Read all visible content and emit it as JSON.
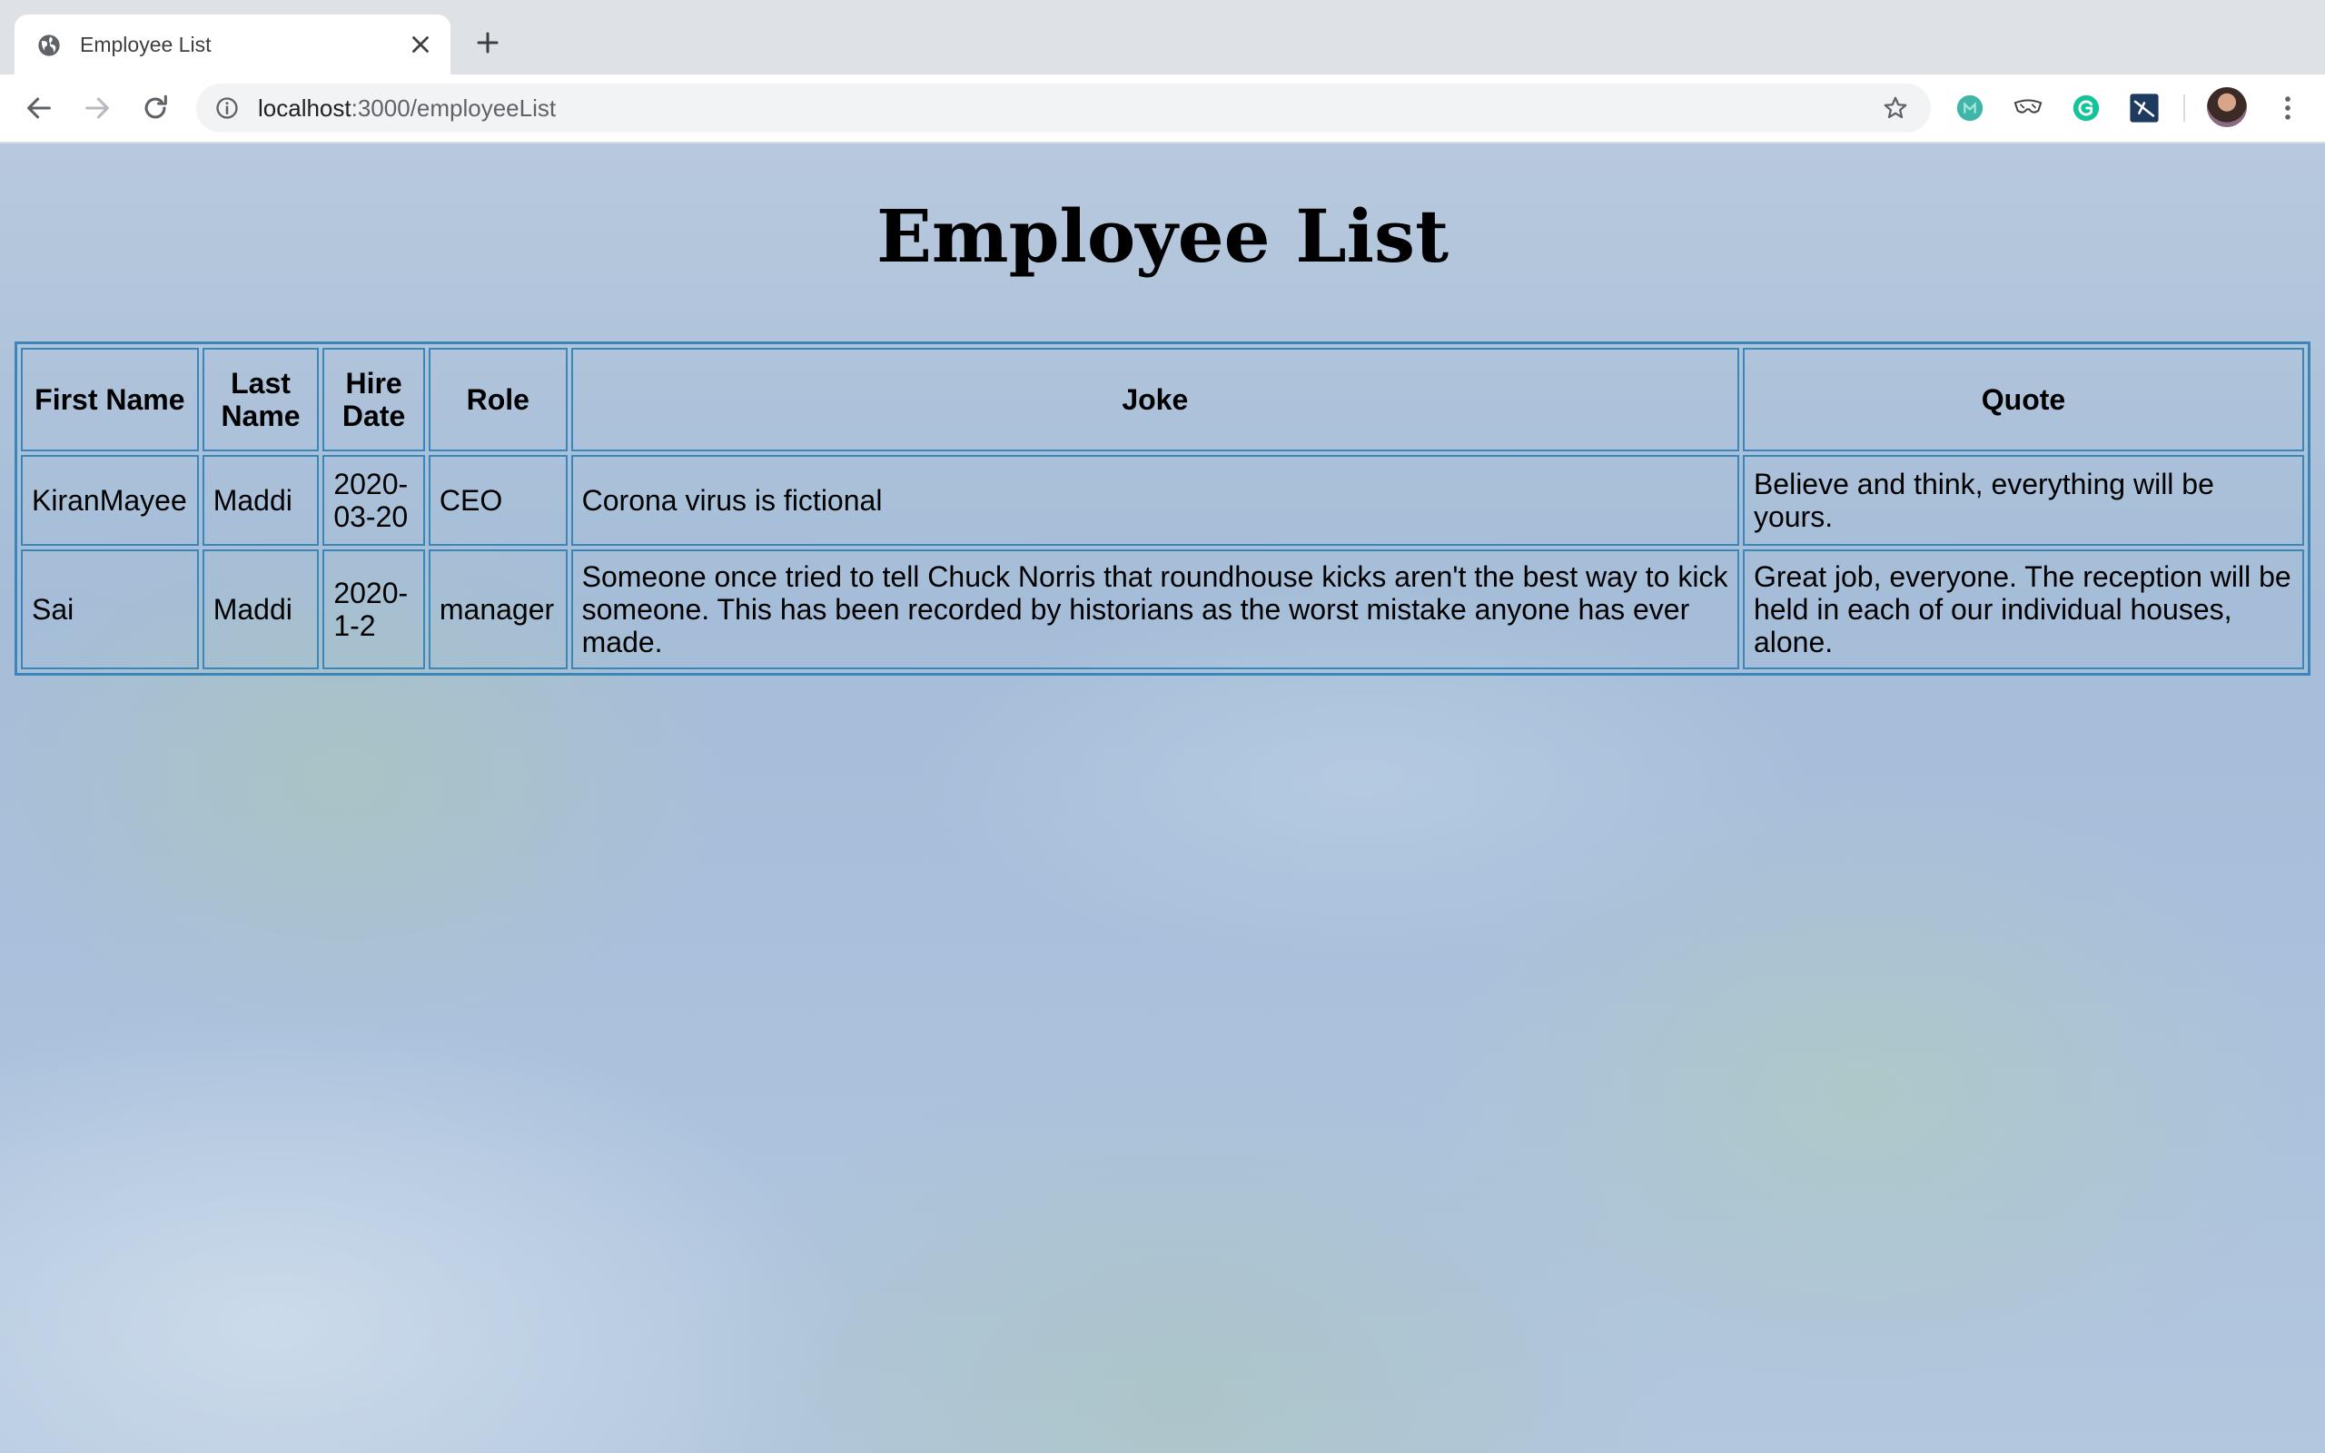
{
  "browser": {
    "tab": {
      "title": "Employee List"
    },
    "address_bar": {
      "host": "localhost",
      "port_path": ":3000/employeeList"
    }
  },
  "page": {
    "title": "Employee List",
    "table": {
      "headers": {
        "first_name": "First Name",
        "last_name": "Last Name",
        "hire_date": "Hire Date",
        "role": "Role",
        "joke": "Joke",
        "quote": "Quote"
      },
      "rows": [
        {
          "first_name": "KiranMayee",
          "last_name": "Maddi",
          "hire_date": "2020-03-20",
          "role": "CEO",
          "joke": "Corona virus is fictional",
          "quote": "Believe and think, everything will be yours."
        },
        {
          "first_name": "Sai",
          "last_name": "Maddi",
          "hire_date": "2020-1-2",
          "role": "manager",
          "joke": "Someone once tried to tell Chuck Norris that roundhouse kicks aren't the best way to kick someone. This has been recorded by historians as the worst mistake anyone has ever made.",
          "quote": "Great job, everyone. The reception will be held in each of our individual houses, alone."
        }
      ]
    }
  },
  "colors": {
    "table_border": "#3a86b8",
    "chrome_tabstrip": "#dee1e6",
    "omnibox": "#f1f3f4"
  },
  "icons": [
    "globe-icon",
    "close-icon",
    "plus-icon",
    "back-icon",
    "forward-icon",
    "reload-icon",
    "info-icon",
    "star-icon",
    "extension-icon",
    "avatar",
    "more-vert-icon"
  ]
}
